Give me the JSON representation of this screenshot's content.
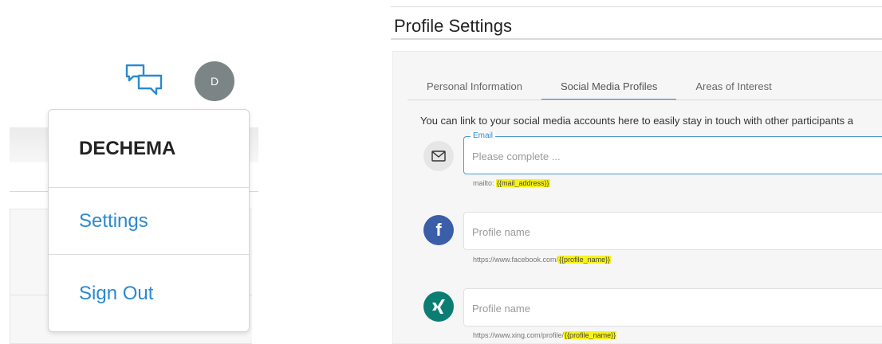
{
  "user_menu": {
    "avatar_initial": "D",
    "organization": "DECHEMA",
    "settings_label": "Settings",
    "sign_out_label": "Sign Out"
  },
  "profile": {
    "title": "Profile Settings",
    "tabs": [
      {
        "label": "Personal Information",
        "active": false
      },
      {
        "label": "Social Media Profiles",
        "active": true
      },
      {
        "label": "Areas of Interest",
        "active": false
      }
    ],
    "intro": "You can link to your social media accounts here to easily stay in touch with other participants a",
    "fields": [
      {
        "icon": "mail-icon",
        "label": "Email",
        "placeholder": "Please complete ...",
        "hint_prefix": "mailto: ",
        "hint_token": "{{mail_address}}"
      },
      {
        "icon": "facebook-icon",
        "placeholder": "Profile name",
        "hint_prefix": "https://www.facebook.com/",
        "hint_token": "{{profile_name}}"
      },
      {
        "icon": "xing-icon",
        "placeholder": "Profile name",
        "hint_prefix": "https://www.xing.com/profile/",
        "hint_token": "{{profile_name}}"
      }
    ]
  },
  "colors": {
    "accent": "#2b89cf",
    "avatar_bg": "#7c8585",
    "facebook": "#3b5ea8",
    "xing": "#0c7d73",
    "highlight": "#f7f318"
  }
}
